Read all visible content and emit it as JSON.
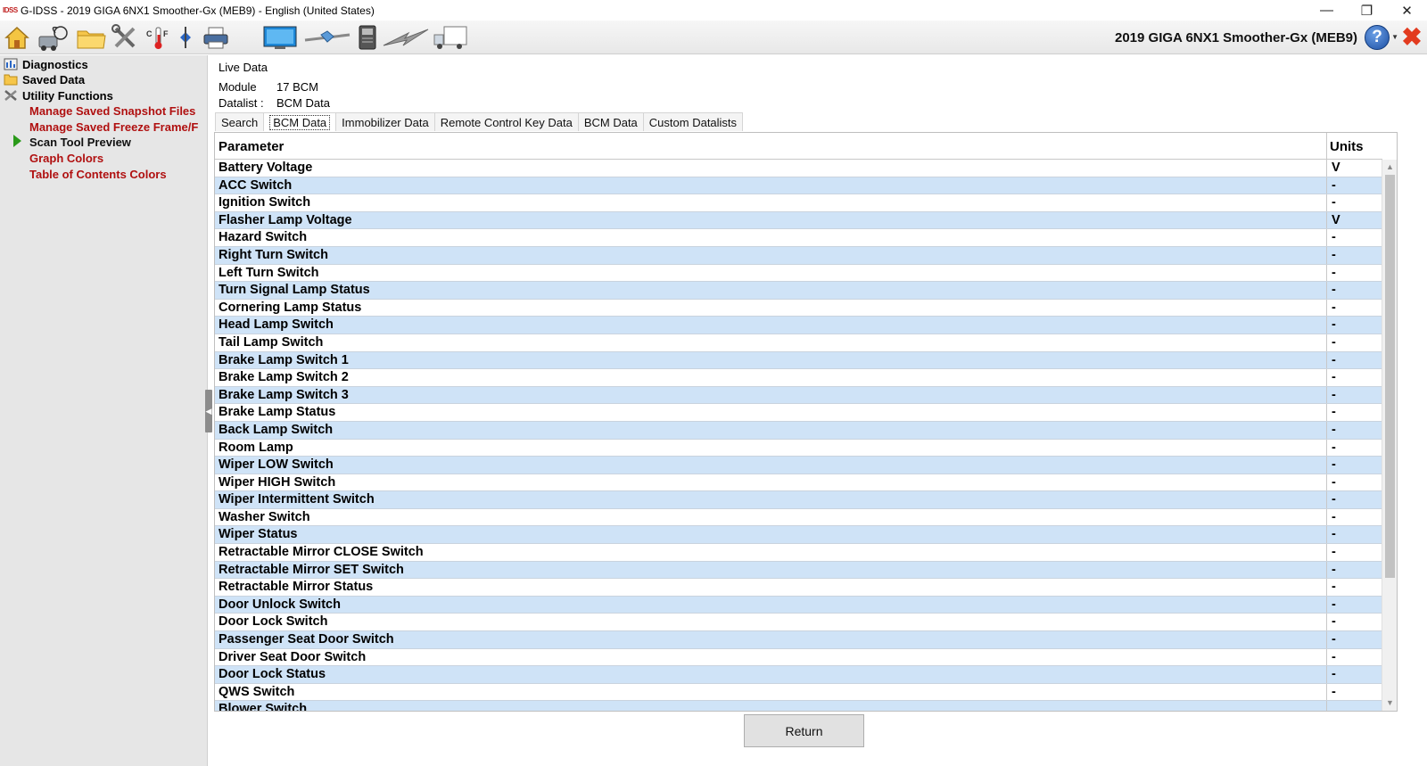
{
  "window": {
    "logo_text": "IDSS",
    "title": "G-IDSS - 2019 GIGA 6NX1 Smoother-Gx (MEB9) - English (United States)",
    "minimize": "—",
    "restore": "❐",
    "close": "✕"
  },
  "toolbar": {
    "vehicle_title": "2019 GIGA 6NX1 Smoother-Gx (MEB9)",
    "help_label": "?",
    "temp_label": "C|F",
    "icons": [
      "home-icon",
      "diagnostics-icon",
      "folder-icon",
      "tools-icon",
      "temperature-icon",
      "split-icon",
      "printer-icon",
      "monitor-icon",
      "connect-icon",
      "device-icon",
      "flash-icon",
      "truck-icon"
    ]
  },
  "sidebar": {
    "items": [
      {
        "label": "Diagnostics"
      },
      {
        "label": "Saved Data"
      },
      {
        "label": "Utility Functions"
      }
    ],
    "links": [
      {
        "label": "Manage Saved Snapshot Files"
      },
      {
        "label": "Manage Saved Freeze Frame/F"
      },
      {
        "label": "Scan Tool Preview"
      },
      {
        "label": "Graph Colors"
      },
      {
        "label": "Table of Contents Colors"
      }
    ]
  },
  "main": {
    "heading": "Live Data",
    "module_label": "Module",
    "module_value": "17 BCM",
    "datalist_label": "Datalist :",
    "datalist_value": "BCM Data",
    "tabs": [
      {
        "label": "Search"
      },
      {
        "label": "BCM Data",
        "active": true
      },
      {
        "label": "Immobilizer Data"
      },
      {
        "label": "Remote Control Key Data"
      },
      {
        "label": "BCM Data"
      },
      {
        "label": "Custom Datalists"
      }
    ],
    "table": {
      "col_parameter": "Parameter",
      "col_units": "Units",
      "rows": [
        {
          "parameter": "Battery Voltage",
          "units": "V"
        },
        {
          "parameter": "ACC Switch",
          "units": "-"
        },
        {
          "parameter": "Ignition Switch",
          "units": "-"
        },
        {
          "parameter": "Flasher Lamp Voltage",
          "units": "V"
        },
        {
          "parameter": "Hazard Switch",
          "units": "-"
        },
        {
          "parameter": "Right Turn Switch",
          "units": "-"
        },
        {
          "parameter": "Left Turn Switch",
          "units": "-"
        },
        {
          "parameter": "Turn Signal Lamp Status",
          "units": "-"
        },
        {
          "parameter": "Cornering Lamp Status",
          "units": "-"
        },
        {
          "parameter": "Head Lamp Switch",
          "units": "-"
        },
        {
          "parameter": "Tail Lamp Switch",
          "units": "-"
        },
        {
          "parameter": "Brake Lamp Switch 1",
          "units": "-"
        },
        {
          "parameter": "Brake Lamp Switch 2",
          "units": "-"
        },
        {
          "parameter": "Brake Lamp Switch 3",
          "units": "-"
        },
        {
          "parameter": "Brake Lamp Status",
          "units": "-"
        },
        {
          "parameter": "Back Lamp Switch",
          "units": "-"
        },
        {
          "parameter": "Room Lamp",
          "units": "-"
        },
        {
          "parameter": "Wiper LOW Switch",
          "units": "-"
        },
        {
          "parameter": "Wiper HIGH Switch",
          "units": "-"
        },
        {
          "parameter": "Wiper Intermittent Switch",
          "units": "-"
        },
        {
          "parameter": "Washer Switch",
          "units": "-"
        },
        {
          "parameter": "Wiper Status",
          "units": "-"
        },
        {
          "parameter": "Retractable Mirror CLOSE Switch",
          "units": "-"
        },
        {
          "parameter": "Retractable Mirror SET Switch",
          "units": "-"
        },
        {
          "parameter": "Retractable Mirror Status",
          "units": "-"
        },
        {
          "parameter": "Door Unlock Switch",
          "units": "-"
        },
        {
          "parameter": "Door Lock Switch",
          "units": "-"
        },
        {
          "parameter": "Passenger Seat Door Switch",
          "units": "-"
        },
        {
          "parameter": "Driver Seat Door Switch",
          "units": "-"
        },
        {
          "parameter": "Door Lock Status",
          "units": "-"
        },
        {
          "parameter": "QWS Switch",
          "units": "-"
        },
        {
          "parameter": "Blower Switch",
          "units": ""
        }
      ]
    },
    "return_label": "Return"
  },
  "colors": {
    "row_alt": "#cfe3f7",
    "link_red": "#b01010",
    "sidebar_bg": "#e6e6e6"
  }
}
